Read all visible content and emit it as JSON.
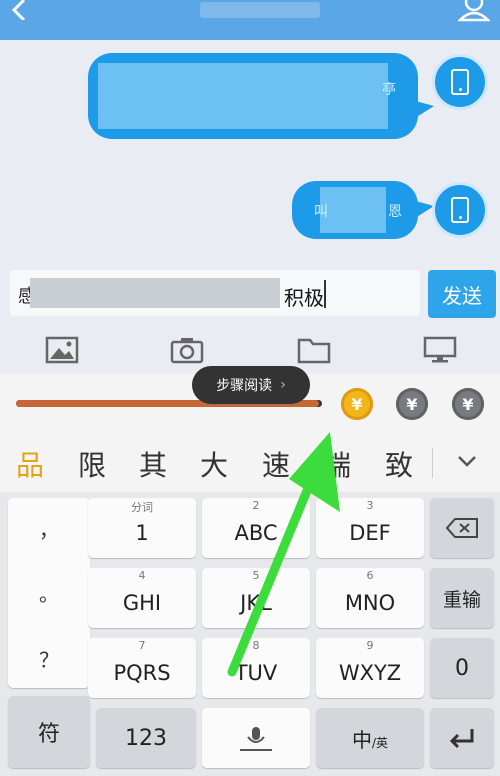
{
  "header": {
    "back_icon": "chevron-left-icon",
    "contact_icon": "person-icon"
  },
  "chat": {
    "messages": [
      {
        "partial_text": "亭",
        "avatar_icon": "phone-icon"
      },
      {
        "partial_text_left": "叫",
        "partial_text_right": "恩",
        "avatar_icon": "phone-icon"
      }
    ]
  },
  "composer": {
    "input_prefix": "感",
    "input_suffix": "积极",
    "send_label": "发送"
  },
  "toolbar": {
    "items": [
      "image-icon",
      "camera-icon",
      "folder-icon",
      "desktop-icon"
    ]
  },
  "keyboard": {
    "tooltip_label": "步骤阅读",
    "tooltip_chevron": "›",
    "progress_fraction": 0.99,
    "coins": [
      "¥",
      "¥",
      "¥"
    ],
    "colors": {
      "accent": "#2ea4ea",
      "gold": "#f2b51a",
      "highlight": "#e3a21a",
      "arrow": "#3ddc3d"
    },
    "candidates": [
      "品",
      "限",
      "其",
      "大",
      "速",
      "端",
      "致"
    ],
    "punctuation": [
      "，",
      "。",
      "？"
    ],
    "keys": [
      {
        "sub": "分词",
        "main": "1"
      },
      {
        "sub": "2",
        "main": "ABC"
      },
      {
        "sub": "3",
        "main": "DEF"
      },
      {
        "sub": "4",
        "main": "GHI"
      },
      {
        "sub": "5",
        "main": "JKL"
      },
      {
        "sub": "6",
        "main": "MNO"
      },
      {
        "sub": "7",
        "main": "PQRS"
      },
      {
        "sub": "8",
        "main": "TUV"
      },
      {
        "sub": "9",
        "main": "WXYZ"
      }
    ],
    "backspace_icon": "backspace-icon",
    "retype_label": "重输",
    "zero_label": "0",
    "symbol_label": "符",
    "num_label": "123",
    "space_icon": "microphone-icon",
    "lang_main": "中",
    "lang_sub": "/英",
    "enter_icon": "enter-icon"
  }
}
